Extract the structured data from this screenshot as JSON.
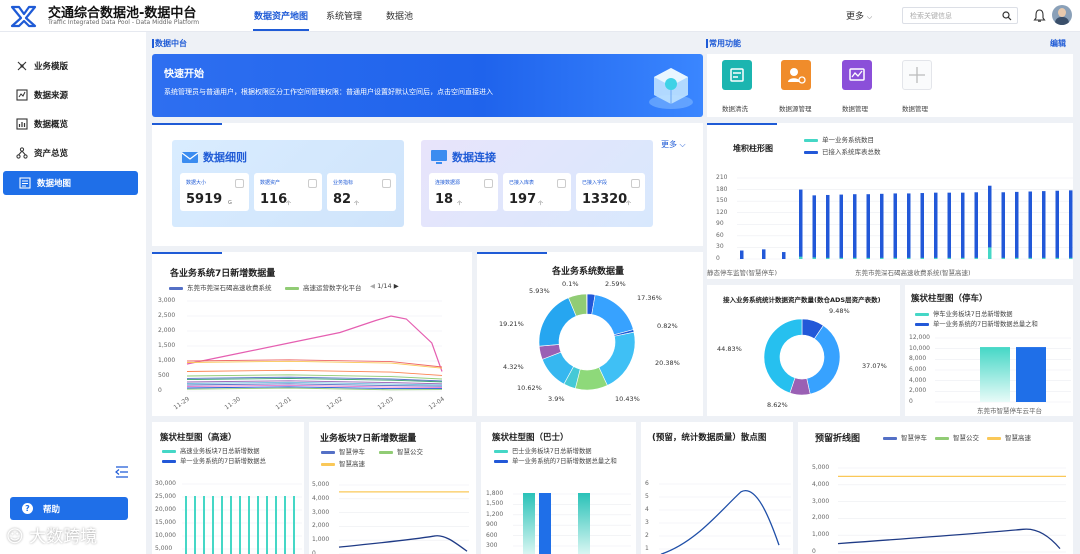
{
  "header": {
    "title": "交通综合数据池-数据中台",
    "subtitle": "Traffic Integrated Data Pool - Data Middle Platform",
    "nav": [
      "数据资产地图",
      "系统管理",
      "数据池"
    ],
    "more": "更多",
    "search_placeholder": "检索关键信息"
  },
  "sidebar": {
    "items": [
      "业务模版",
      "数据来源",
      "数据概览",
      "资产总览",
      "数据地图"
    ],
    "active_index": 4,
    "help": "帮助"
  },
  "sections": {
    "data_center": "数据中台",
    "common": "常用功能",
    "edit": "编辑",
    "more": "更多"
  },
  "banner": {
    "title": "快速开始",
    "text": "系统管理员与普通用户，根据权限区分工作空间管理权限：普通用户设置好默认空间后，点击空间直接进入"
  },
  "shortcuts": [
    "数据清洗",
    "数据源管理",
    "数据管理",
    "数据管理"
  ],
  "detail": {
    "title": "数据细则",
    "metrics": [
      {
        "label": "数据大小",
        "value": "5919",
        "unit": "G"
      },
      {
        "label": "数据资产",
        "value": "116",
        "unit": "个"
      },
      {
        "label": "业务指标",
        "value": "82",
        "unit": "个"
      }
    ]
  },
  "connect": {
    "title": "数据连接",
    "metrics": [
      {
        "label": "连接数据源",
        "value": "18",
        "unit": "个"
      },
      {
        "label": "已接入库表",
        "value": "197",
        "unit": "个"
      },
      {
        "label": "已接入字段",
        "value": "13320",
        "unit": "个"
      }
    ]
  },
  "stack_chart": {
    "title": "堆积柱形图",
    "legend": [
      "单一业务系统数目",
      "已接入系统库表总数"
    ],
    "yticks": [
      "210",
      "180",
      "150",
      "120",
      "90",
      "60",
      "30",
      "0"
    ],
    "xlabels": [
      "静态停车监管(智慧停车)",
      "东莞市莞深石碣高速收费系统(智慧高速)"
    ],
    "colors": [
      "#45d7c6",
      "#2258d8"
    ]
  },
  "chart_data": [
    {
      "type": "line",
      "title": "各业务系统7日新增数据量",
      "legend": [
        "东莞市莞深石碣高速收费系统",
        "高速运营数字化平台"
      ],
      "page": "1/14",
      "yticks": [
        "3,000",
        "2,500",
        "2,000",
        "1,500",
        "1,000",
        "500",
        "0"
      ],
      "x": [
        "11-29",
        "11-30",
        "12-01",
        "12-02",
        "12-03",
        "12-04"
      ],
      "ylim": [
        0,
        3000
      ]
    },
    {
      "type": "pie",
      "title": "各业务系统数据量",
      "labels": [
        "2.59%",
        "17.36%",
        "0.82%",
        "20.38%",
        "10.43%",
        "3.9%",
        "10.62%",
        "4.32%",
        "19.21%",
        "5.93%",
        "0.1%"
      ],
      "values": [
        2.59,
        17.36,
        0.82,
        20.38,
        10.43,
        3.9,
        10.62,
        4.32,
        19.21,
        5.93,
        0.1
      ]
    },
    {
      "type": "pie",
      "title": "接入业务系统统计数据资产数量(数仓ADS层资产表数)",
      "labels": [
        "9.48%",
        "37.07%",
        "8.62%",
        "44.83%"
      ],
      "values": [
        9.48,
        37.07,
        8.62,
        44.83
      ]
    },
    {
      "type": "bar",
      "title": "簇状柱型图（停车）",
      "legend": [
        "停车业务板块7日总新增数据",
        "单一业务系统的7日新增数据总量之和"
      ],
      "categories": [
        "东莞市智慧停车云平台"
      ],
      "yticks": [
        "12,000",
        "10,000",
        "8,000",
        "6,000",
        "4,000",
        "2,000",
        "0"
      ],
      "series": [
        {
          "name": "停车业务板块7日总新增数据",
          "values": [
            10300
          ]
        },
        {
          "name": "单一业务系统的7日新增数据总量之和",
          "values": [
            10300
          ]
        }
      ]
    },
    {
      "type": "bar",
      "title": "簇状柱型图（高速）",
      "legend": [
        "高速业务板块7日总新增数据",
        "单一业务系统的7日新增数据总"
      ],
      "yticks": [
        "30,000",
        "25,000",
        "20,000",
        "15,000",
        "10,000",
        "5,000"
      ]
    },
    {
      "type": "line",
      "title": "业务板块7日新增数据量",
      "legend": [
        "智慧停车",
        "智慧公交",
        "智慧高速"
      ],
      "yticks": [
        "5,000",
        "4,000",
        "3,000",
        "2,000",
        "1,000",
        "0"
      ]
    },
    {
      "type": "bar",
      "title": "簇状柱型图（巴士）",
      "legend": [
        "巴士业务板块7日总新增数据",
        "单一业务系统的7日新增数据总量之和"
      ],
      "yticks": [
        "1,800",
        "1,500",
        "1,200",
        "900",
        "600",
        "300"
      ]
    },
    {
      "type": "scatter",
      "title": "(预留，统计数据质量）散点图",
      "yticks": [
        "6",
        "5",
        "4",
        "3",
        "2",
        "1"
      ]
    },
    {
      "type": "line",
      "title": "预留折线图",
      "legend": [
        "智慧停车",
        "智慧公交",
        "智慧高速"
      ],
      "yticks": [
        "5,000",
        "4,000",
        "3,000",
        "2,000",
        "1,000",
        "0"
      ]
    }
  ],
  "watermark": "大数跨境"
}
